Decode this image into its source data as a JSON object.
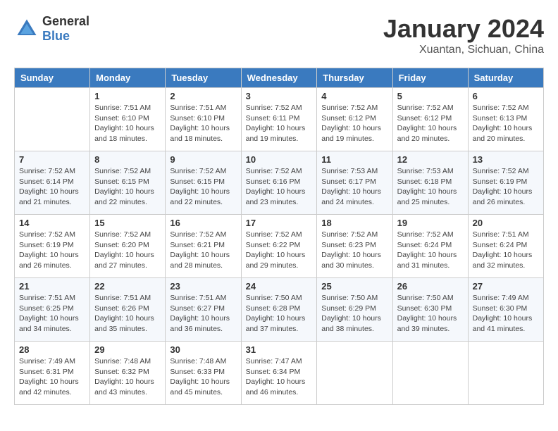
{
  "header": {
    "logo_line1": "General",
    "logo_line2": "Blue",
    "month": "January 2024",
    "location": "Xuantan, Sichuan, China"
  },
  "days_of_week": [
    "Sunday",
    "Monday",
    "Tuesday",
    "Wednesday",
    "Thursday",
    "Friday",
    "Saturday"
  ],
  "weeks": [
    [
      {
        "day": "",
        "sunrise": "",
        "sunset": "",
        "daylight": ""
      },
      {
        "day": "1",
        "sunrise": "Sunrise: 7:51 AM",
        "sunset": "Sunset: 6:10 PM",
        "daylight": "Daylight: 10 hours and 18 minutes."
      },
      {
        "day": "2",
        "sunrise": "Sunrise: 7:51 AM",
        "sunset": "Sunset: 6:10 PM",
        "daylight": "Daylight: 10 hours and 18 minutes."
      },
      {
        "day": "3",
        "sunrise": "Sunrise: 7:52 AM",
        "sunset": "Sunset: 6:11 PM",
        "daylight": "Daylight: 10 hours and 19 minutes."
      },
      {
        "day": "4",
        "sunrise": "Sunrise: 7:52 AM",
        "sunset": "Sunset: 6:12 PM",
        "daylight": "Daylight: 10 hours and 19 minutes."
      },
      {
        "day": "5",
        "sunrise": "Sunrise: 7:52 AM",
        "sunset": "Sunset: 6:12 PM",
        "daylight": "Daylight: 10 hours and 20 minutes."
      },
      {
        "day": "6",
        "sunrise": "Sunrise: 7:52 AM",
        "sunset": "Sunset: 6:13 PM",
        "daylight": "Daylight: 10 hours and 20 minutes."
      }
    ],
    [
      {
        "day": "7",
        "sunrise": "Sunrise: 7:52 AM",
        "sunset": "Sunset: 6:14 PM",
        "daylight": "Daylight: 10 hours and 21 minutes."
      },
      {
        "day": "8",
        "sunrise": "Sunrise: 7:52 AM",
        "sunset": "Sunset: 6:15 PM",
        "daylight": "Daylight: 10 hours and 22 minutes."
      },
      {
        "day": "9",
        "sunrise": "Sunrise: 7:52 AM",
        "sunset": "Sunset: 6:15 PM",
        "daylight": "Daylight: 10 hours and 22 minutes."
      },
      {
        "day": "10",
        "sunrise": "Sunrise: 7:52 AM",
        "sunset": "Sunset: 6:16 PM",
        "daylight": "Daylight: 10 hours and 23 minutes."
      },
      {
        "day": "11",
        "sunrise": "Sunrise: 7:53 AM",
        "sunset": "Sunset: 6:17 PM",
        "daylight": "Daylight: 10 hours and 24 minutes."
      },
      {
        "day": "12",
        "sunrise": "Sunrise: 7:53 AM",
        "sunset": "Sunset: 6:18 PM",
        "daylight": "Daylight: 10 hours and 25 minutes."
      },
      {
        "day": "13",
        "sunrise": "Sunrise: 7:52 AM",
        "sunset": "Sunset: 6:19 PM",
        "daylight": "Daylight: 10 hours and 26 minutes."
      }
    ],
    [
      {
        "day": "14",
        "sunrise": "Sunrise: 7:52 AM",
        "sunset": "Sunset: 6:19 PM",
        "daylight": "Daylight: 10 hours and 26 minutes."
      },
      {
        "day": "15",
        "sunrise": "Sunrise: 7:52 AM",
        "sunset": "Sunset: 6:20 PM",
        "daylight": "Daylight: 10 hours and 27 minutes."
      },
      {
        "day": "16",
        "sunrise": "Sunrise: 7:52 AM",
        "sunset": "Sunset: 6:21 PM",
        "daylight": "Daylight: 10 hours and 28 minutes."
      },
      {
        "day": "17",
        "sunrise": "Sunrise: 7:52 AM",
        "sunset": "Sunset: 6:22 PM",
        "daylight": "Daylight: 10 hours and 29 minutes."
      },
      {
        "day": "18",
        "sunrise": "Sunrise: 7:52 AM",
        "sunset": "Sunset: 6:23 PM",
        "daylight": "Daylight: 10 hours and 30 minutes."
      },
      {
        "day": "19",
        "sunrise": "Sunrise: 7:52 AM",
        "sunset": "Sunset: 6:24 PM",
        "daylight": "Daylight: 10 hours and 31 minutes."
      },
      {
        "day": "20",
        "sunrise": "Sunrise: 7:51 AM",
        "sunset": "Sunset: 6:24 PM",
        "daylight": "Daylight: 10 hours and 32 minutes."
      }
    ],
    [
      {
        "day": "21",
        "sunrise": "Sunrise: 7:51 AM",
        "sunset": "Sunset: 6:25 PM",
        "daylight": "Daylight: 10 hours and 34 minutes."
      },
      {
        "day": "22",
        "sunrise": "Sunrise: 7:51 AM",
        "sunset": "Sunset: 6:26 PM",
        "daylight": "Daylight: 10 hours and 35 minutes."
      },
      {
        "day": "23",
        "sunrise": "Sunrise: 7:51 AM",
        "sunset": "Sunset: 6:27 PM",
        "daylight": "Daylight: 10 hours and 36 minutes."
      },
      {
        "day": "24",
        "sunrise": "Sunrise: 7:50 AM",
        "sunset": "Sunset: 6:28 PM",
        "daylight": "Daylight: 10 hours and 37 minutes."
      },
      {
        "day": "25",
        "sunrise": "Sunrise: 7:50 AM",
        "sunset": "Sunset: 6:29 PM",
        "daylight": "Daylight: 10 hours and 38 minutes."
      },
      {
        "day": "26",
        "sunrise": "Sunrise: 7:50 AM",
        "sunset": "Sunset: 6:30 PM",
        "daylight": "Daylight: 10 hours and 39 minutes."
      },
      {
        "day": "27",
        "sunrise": "Sunrise: 7:49 AM",
        "sunset": "Sunset: 6:30 PM",
        "daylight": "Daylight: 10 hours and 41 minutes."
      }
    ],
    [
      {
        "day": "28",
        "sunrise": "Sunrise: 7:49 AM",
        "sunset": "Sunset: 6:31 PM",
        "daylight": "Daylight: 10 hours and 42 minutes."
      },
      {
        "day": "29",
        "sunrise": "Sunrise: 7:48 AM",
        "sunset": "Sunset: 6:32 PM",
        "daylight": "Daylight: 10 hours and 43 minutes."
      },
      {
        "day": "30",
        "sunrise": "Sunrise: 7:48 AM",
        "sunset": "Sunset: 6:33 PM",
        "daylight": "Daylight: 10 hours and 45 minutes."
      },
      {
        "day": "31",
        "sunrise": "Sunrise: 7:47 AM",
        "sunset": "Sunset: 6:34 PM",
        "daylight": "Daylight: 10 hours and 46 minutes."
      },
      {
        "day": "",
        "sunrise": "",
        "sunset": "",
        "daylight": ""
      },
      {
        "day": "",
        "sunrise": "",
        "sunset": "",
        "daylight": ""
      },
      {
        "day": "",
        "sunrise": "",
        "sunset": "",
        "daylight": ""
      }
    ]
  ]
}
